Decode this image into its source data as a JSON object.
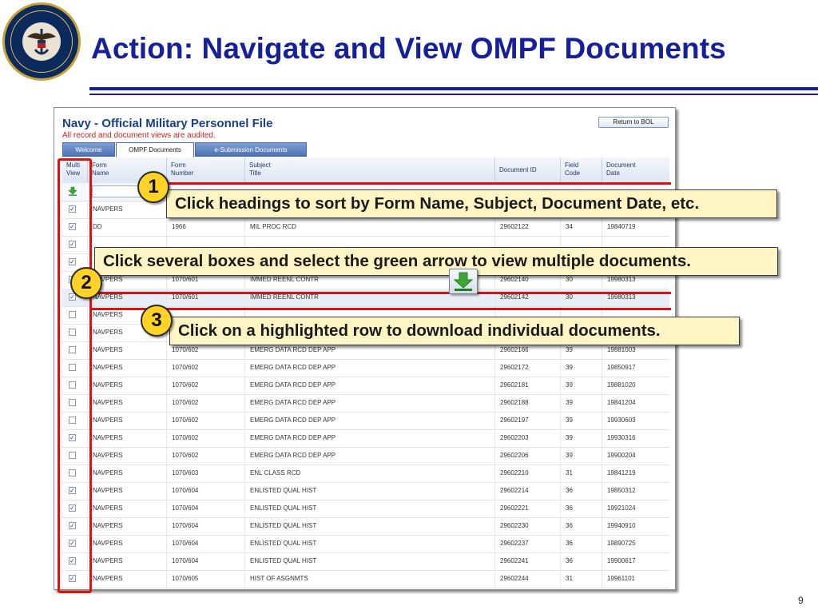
{
  "slide": {
    "title": "Action: Navigate and View OMPF Documents",
    "page_number": "9",
    "logo": {
      "text": "UNITED STATES NAVY · CHIEF OF NAVAL OPERATIONS",
      "colors": {
        "navy": "#0c2a5c",
        "gold": "#c9a23a"
      }
    }
  },
  "app": {
    "title": "Navy - Official Military Personnel File",
    "subtitle": "All record and document views are audited.",
    "return_button": "Return to BOL",
    "tabs": [
      {
        "label": "Welcome",
        "active": false
      },
      {
        "label": "OMPF Documents",
        "active": true
      },
      {
        "label": "e-Submission Documents",
        "active": false
      }
    ],
    "columns": [
      {
        "line1": "Multi",
        "line2": "View"
      },
      {
        "line1": "Form",
        "line2": "Name"
      },
      {
        "line1": "Form",
        "line2": "Number"
      },
      {
        "line1": "Subject",
        "line2": "Title"
      },
      {
        "line1": "Document ID",
        "line2": ""
      },
      {
        "line1": "Field",
        "line2": "Code"
      },
      {
        "line1": "Document",
        "line2": "Date"
      }
    ],
    "rows": [
      {
        "checked": true,
        "form_name": "NAVPERS",
        "form_number": "",
        "subject": "",
        "doc_id": "",
        "field_code": "",
        "doc_date": ""
      },
      {
        "checked": true,
        "form_name": "DD",
        "form_number": "1966",
        "subject": "MIL PROC RCD",
        "doc_id": "29602122",
        "field_code": "34",
        "doc_date": "19840719"
      },
      {
        "checked": true,
        "form_name": "",
        "form_number": "",
        "subject": "",
        "doc_id": "",
        "field_code": "",
        "doc_date": ""
      },
      {
        "checked": true,
        "form_name": "",
        "form_number": "",
        "subject": "",
        "doc_id": "",
        "field_code": "",
        "doc_date": ""
      },
      {
        "checked": false,
        "form_name": "NAVPERS",
        "form_number": "1070/601",
        "subject": "IMMED REENL CONTR",
        "doc_id": "29602140",
        "field_code": "30",
        "doc_date": "19980313"
      },
      {
        "checked": true,
        "form_name": "NAVPERS",
        "form_number": "1070/601",
        "subject": "IMMED REENL CONTR",
        "doc_id": "29602142",
        "field_code": "30",
        "doc_date": "19980313",
        "highlighted": true
      },
      {
        "checked": false,
        "form_name": "NAVPERS",
        "form_number": "",
        "subject": "",
        "doc_id": "",
        "field_code": "",
        "doc_date": ""
      },
      {
        "checked": false,
        "form_name": "NAVPERS",
        "form_number": "",
        "subject": "",
        "doc_id": "",
        "field_code": "",
        "doc_date": ""
      },
      {
        "checked": false,
        "form_name": "NAVPERS",
        "form_number": "1070/602",
        "subject": "EMERG DATA RCD DEP APP",
        "doc_id": "29602166",
        "field_code": "39",
        "doc_date": "19881003"
      },
      {
        "checked": false,
        "form_name": "NAVPERS",
        "form_number": "1070/602",
        "subject": "EMERG DATA RCD DEP APP",
        "doc_id": "29602172",
        "field_code": "39",
        "doc_date": "19850917"
      },
      {
        "checked": false,
        "form_name": "NAVPERS",
        "form_number": "1070/602",
        "subject": "EMERG DATA RCD DEP APP",
        "doc_id": "29602181",
        "field_code": "39",
        "doc_date": "19881020"
      },
      {
        "checked": false,
        "form_name": "NAVPERS",
        "form_number": "1070/602",
        "subject": "EMERG DATA RCD DEP APP",
        "doc_id": "29602188",
        "field_code": "39",
        "doc_date": "19841204"
      },
      {
        "checked": false,
        "form_name": "NAVPERS",
        "form_number": "1070/602",
        "subject": "EMERG DATA RCD DEP APP",
        "doc_id": "29602197",
        "field_code": "39",
        "doc_date": "19930603"
      },
      {
        "checked": true,
        "form_name": "NAVPERS",
        "form_number": "1070/602",
        "subject": "EMERG DATA RCD DEP APP",
        "doc_id": "29602203",
        "field_code": "39",
        "doc_date": "19930316"
      },
      {
        "checked": false,
        "form_name": "NAVPERS",
        "form_number": "1070/602",
        "subject": "EMERG DATA RCD DEP APP",
        "doc_id": "29602206",
        "field_code": "39",
        "doc_date": "19900204"
      },
      {
        "checked": false,
        "form_name": "NAVPERS",
        "form_number": "1070/603",
        "subject": "ENL CLASS RCD",
        "doc_id": "29602210",
        "field_code": "31",
        "doc_date": "19841219"
      },
      {
        "checked": true,
        "form_name": "NAVPERS",
        "form_number": "1070/604",
        "subject": "ENLISTED QUAL HIST",
        "doc_id": "29602214",
        "field_code": "36",
        "doc_date": "19850312"
      },
      {
        "checked": true,
        "form_name": "NAVPERS",
        "form_number": "1070/604",
        "subject": "ENLISTED QUAL HIST",
        "doc_id": "29602221",
        "field_code": "36",
        "doc_date": "19921024"
      },
      {
        "checked": true,
        "form_name": "NAVPERS",
        "form_number": "1070/604",
        "subject": "ENLISTED QUAL HIST",
        "doc_id": "29602230",
        "field_code": "36",
        "doc_date": "19940910"
      },
      {
        "checked": true,
        "form_name": "NAVPERS",
        "form_number": "1070/604",
        "subject": "ENLISTED QUAL HIST",
        "doc_id": "29602237",
        "field_code": "36",
        "doc_date": "19890725"
      },
      {
        "checked": true,
        "form_name": "NAVPERS",
        "form_number": "1070/604",
        "subject": "ENLISTED QUAL HIST",
        "doc_id": "29602241",
        "field_code": "36",
        "doc_date": "19900617"
      },
      {
        "checked": true,
        "form_name": "NAVPERS",
        "form_number": "1070/605",
        "subject": "HIST OF ASGNMTS",
        "doc_id": "29602244",
        "field_code": "31",
        "doc_date": "19961101"
      }
    ]
  },
  "callouts": [
    {
      "number": "1",
      "text": "Click headings to sort by Form Name, Subject, Document Date, etc."
    },
    {
      "number": "2",
      "text": "Click several boxes and select the green arrow to view multiple documents."
    },
    {
      "number": "3",
      "text": "Click on a highlighted row to download individual documents."
    }
  ],
  "colors": {
    "title_blue": "#16209a",
    "annotation_red": "#e01010",
    "callout_fill": "#fff5c4",
    "badge_yellow": "#ffd227",
    "download_green": "#3fa535"
  },
  "icons": {
    "download": "green-down-arrow-icon"
  }
}
